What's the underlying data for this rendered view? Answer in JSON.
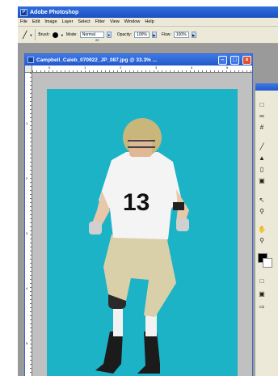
{
  "app": {
    "title": "Adobe Photoshop"
  },
  "menu": [
    "File",
    "Edit",
    "Image",
    "Layer",
    "Select",
    "Filter",
    "View",
    "Window",
    "Help"
  ],
  "options": {
    "brush_label": "Brush:",
    "brush_size": "20",
    "mode_label": "Mode:",
    "mode_value": "Normal",
    "opacity_label": "Opacity:",
    "opacity_value": "100%",
    "flow_label": "Flow:",
    "flow_value": "100%"
  },
  "document": {
    "title": "Campbell_Caleb_070922_JP_087.jpg @ 33.3% ...",
    "background_color": "#1cb3c6",
    "jersey_number": "13"
  },
  "rulers": {
    "h": [
      "0",
      "1",
      "2",
      "3",
      "4",
      "5"
    ],
    "v": [
      "1",
      "2",
      "3",
      "4",
      "5"
    ]
  },
  "colors": {
    "foreground": "#000000",
    "background": "#ffffff",
    "accent": "#2457c8"
  },
  "icons": [
    "brush-tool-icon",
    "marquee-icon",
    "lasso-icon",
    "crop-icon",
    "brush-icon",
    "stamp-icon",
    "eraser-icon",
    "gradient-icon",
    "pen-icon",
    "path-select-icon",
    "hand-icon",
    "zoom-icon"
  ]
}
